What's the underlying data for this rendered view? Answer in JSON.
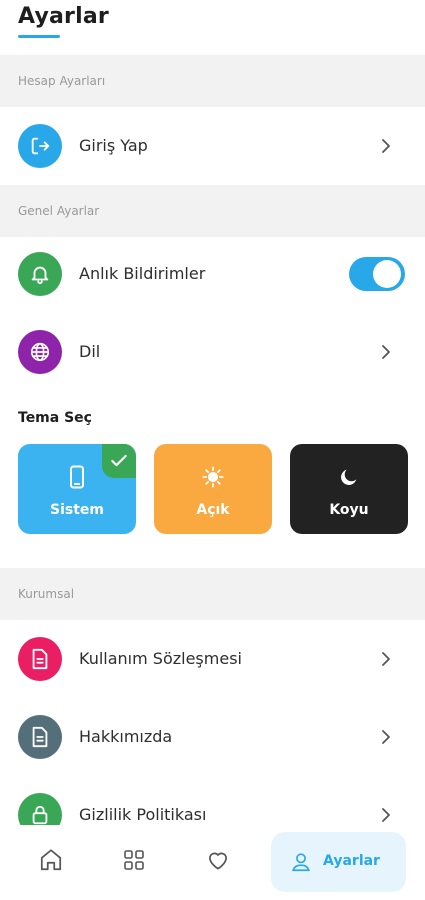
{
  "header": {
    "title": "Ayarlar"
  },
  "sections": {
    "account": "Hesap Ayarları",
    "general": "Genel Ayarlar",
    "corporate": "Kurumsal"
  },
  "rows": {
    "login": {
      "label": "Giriş Yap",
      "icon": "login-icon",
      "color": "#29a8e9"
    },
    "notifications": {
      "label": "Anlık Bildirimler",
      "icon": "bell-icon",
      "color": "#3aa757",
      "enabled": true
    },
    "language": {
      "label": "Dil",
      "icon": "globe-icon",
      "color": "#8e24aa"
    },
    "terms": {
      "label": "Kullanım Sözleşmesi",
      "icon": "document-icon",
      "color": "#e91e63"
    },
    "about": {
      "label": "Hakkımızda",
      "icon": "document-icon",
      "color": "#546e7a"
    },
    "privacy": {
      "label": "Gizlilik Politikası",
      "icon": "lock-icon",
      "color": "#3aa757"
    }
  },
  "theme": {
    "title": "Tema Seç",
    "options": [
      {
        "label": "Sistem",
        "icon": "phone-icon",
        "color": "#3bb3f0",
        "selected": true
      },
      {
        "label": "Açık",
        "icon": "sun-icon",
        "color": "#f9a93f",
        "selected": false
      },
      {
        "label": "Koyu",
        "icon": "moon-icon",
        "color": "#222222",
        "selected": false
      }
    ]
  },
  "bottom_nav": {
    "items": [
      {
        "icon": "home-icon"
      },
      {
        "icon": "grid-icon"
      },
      {
        "icon": "heart-icon"
      }
    ],
    "active": {
      "icon": "user-icon",
      "label": "Ayarlar"
    }
  },
  "colors": {
    "accent": "#29a8e9",
    "section_bg": "#f2f2f2",
    "success": "#3aa757"
  }
}
